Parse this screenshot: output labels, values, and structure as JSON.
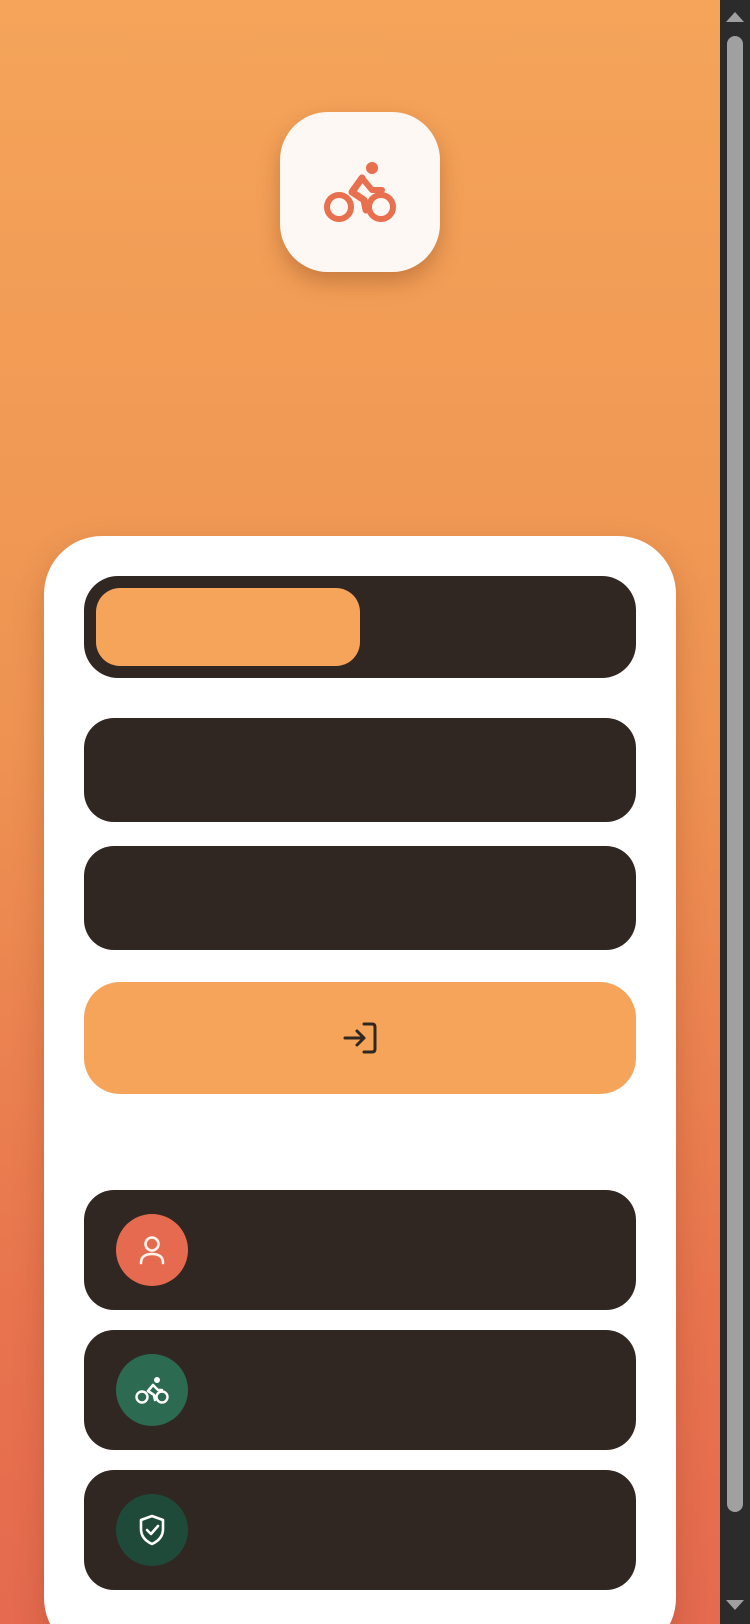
{
  "app": {
    "logo_icon": "bicycle-rider-icon",
    "logo_icon_color": "#e8704e"
  },
  "auth": {
    "tabs": [
      {
        "label": "",
        "selected": true
      },
      {
        "label": "",
        "selected": false
      }
    ],
    "fields": [
      {
        "placeholder": "",
        "value": ""
      },
      {
        "placeholder": "",
        "value": ""
      }
    ],
    "submit": {
      "label": "",
      "icon": "login-arrow-icon"
    }
  },
  "features": [
    {
      "icon": "user-icon",
      "color": "#e66a4f",
      "label": ""
    },
    {
      "icon": "bicycle-icon",
      "color": "#2d6a52",
      "label": ""
    },
    {
      "icon": "shield-check-icon",
      "color": "#1f4a39",
      "label": ""
    }
  ],
  "colors": {
    "accent": "#f5a45a",
    "dark": "#302722",
    "card": "#ffffff"
  }
}
